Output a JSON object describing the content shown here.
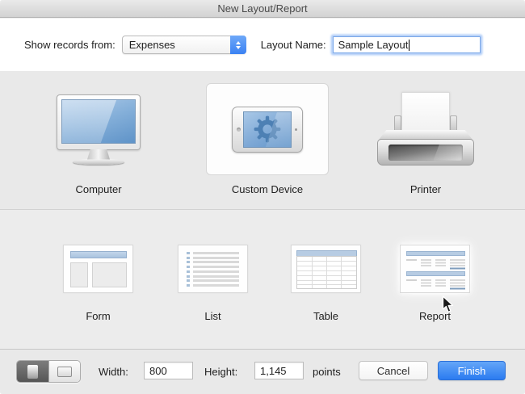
{
  "window": {
    "title": "New Layout/Report"
  },
  "form": {
    "show_records_label": "Show records from:",
    "records_source": "Expenses",
    "layout_name_label": "Layout Name:",
    "layout_name_value": "Sample Layout"
  },
  "devices": [
    {
      "label": "Computer",
      "selected": false
    },
    {
      "label": "Custom Device",
      "selected": true
    },
    {
      "label": "Printer",
      "selected": false
    }
  ],
  "layout_types": [
    {
      "label": "Form"
    },
    {
      "label": "List"
    },
    {
      "label": "Table"
    },
    {
      "label": "Report"
    }
  ],
  "footer": {
    "width_label": "Width:",
    "width_value": "800",
    "height_label": "Height:",
    "height_value": "1,145",
    "points_label": "points",
    "cancel_label": "Cancel",
    "finish_label": "Finish"
  },
  "icons": {
    "popup_stepper": "up-down-chevrons",
    "computer": "imac-monitor",
    "custom_device": "tablet-with-gear",
    "printer": "printer-with-paper",
    "orientation_left": "portrait-page",
    "orientation_right": "landscape-page",
    "pointer": "mouse-arrow-cursor"
  },
  "colors": {
    "accent_blue": "#3b82f3",
    "screen_blue": "#7fa9d6",
    "section_bg": "#e9e9e9",
    "selected_card_bg": "#fdfdfd",
    "finish_button": "#2b7bf0"
  }
}
